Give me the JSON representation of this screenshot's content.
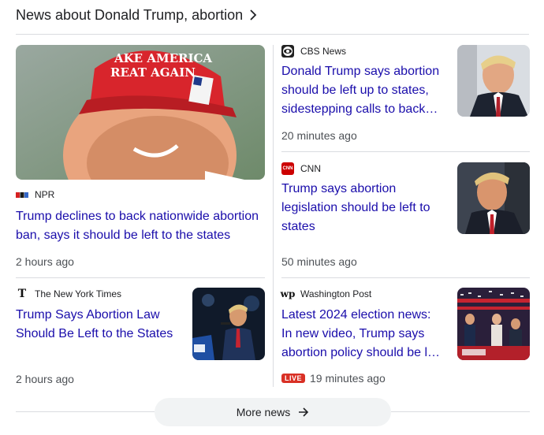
{
  "header": {
    "title": "News about Donald Trump, abortion"
  },
  "articles": [
    {
      "source": "NPR",
      "logo_icon": "npr-logo-icon",
      "headline": "Trump declines to back nationwide abortion ban, says it should be left to the states",
      "time": "2 hours ago"
    },
    {
      "source": "CBS News",
      "logo_icon": "cbs-eye-icon",
      "headline_lines": [
        "Donald Trump says abortion",
        "should be left up to states,",
        "sidestepping calls to back…"
      ],
      "time": "20 minutes ago"
    },
    {
      "source": "CNN",
      "logo_icon": "cnn-logo-icon",
      "headline_lines": [
        "Trump says abortion",
        "legislation should be left to",
        "states"
      ],
      "time": "50 minutes ago"
    },
    {
      "source": "The New York Times",
      "logo_icon": "nyt-logo-icon",
      "headline_lines": [
        "Trump Says Abortion Law",
        "Should Be Left to the States"
      ],
      "time": "2 hours ago"
    },
    {
      "source": "Washington Post",
      "logo_icon": "wapo-logo-icon",
      "headline_lines": [
        "Latest 2024 election news:",
        "In new video, Trump says",
        "abortion policy should be l…"
      ],
      "live": "LIVE",
      "time": "19 minutes ago"
    }
  ],
  "hat_text": [
    "AKE AMERICA",
    "REAT AGAIN"
  ],
  "cnn_logo_text": "CNN",
  "more_button": {
    "label": "More news"
  },
  "colors": {
    "link": "#1a0dab",
    "divider": "#dadce0",
    "live": "#d93025"
  }
}
